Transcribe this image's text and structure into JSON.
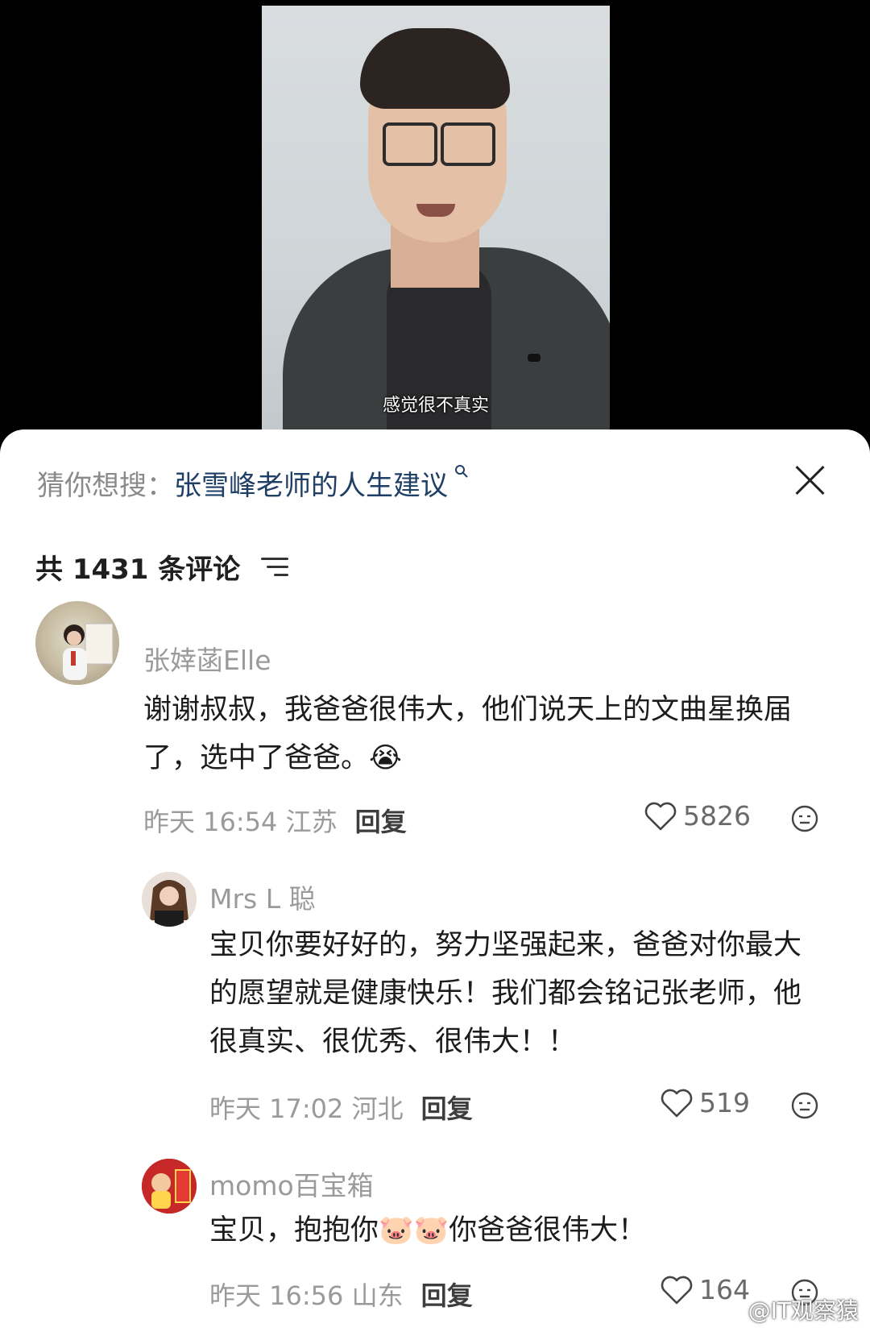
{
  "video": {
    "subtitle": "感觉很不真实"
  },
  "search_suggestion": {
    "prefix": "猜你想搜：",
    "keyword": "张雪峰老师的人生建议",
    "close_icon": "close-icon"
  },
  "comments_header": {
    "count_label": "共 1431 条评论",
    "sort_icon": "sort-lines-icon"
  },
  "comments": [
    {
      "username": "张婞菡Elle",
      "text": "谢谢叔叔，我爸爸很伟大，他们说天上的文曲星换届了，选中了爸爸。😭",
      "time_location": "昨天 16:54 江苏",
      "reply_label": "回复",
      "likes": "5826"
    },
    {
      "username": "Mrs L 聪",
      "text": "宝贝你要好好的，努力坚强起来，爸爸对你最大的愿望就是健康快乐！我们都会铭记张老师，他很真实、很优秀、很伟大！！",
      "time_location": "昨天 17:02 河北",
      "reply_label": "回复",
      "likes": "519"
    },
    {
      "username": "momo百宝箱",
      "text": "宝贝，抱抱你🐷🐷你爸爸很伟大！",
      "time_location": "昨天 16:56 山东",
      "reply_label": "回复",
      "likes": "164"
    }
  ],
  "watermark": "@IT观察猿",
  "colors": {
    "keyword": "#1f3f66",
    "meta_gray": "#9a9a9a",
    "background": "#000000",
    "panel": "#ffffff"
  }
}
